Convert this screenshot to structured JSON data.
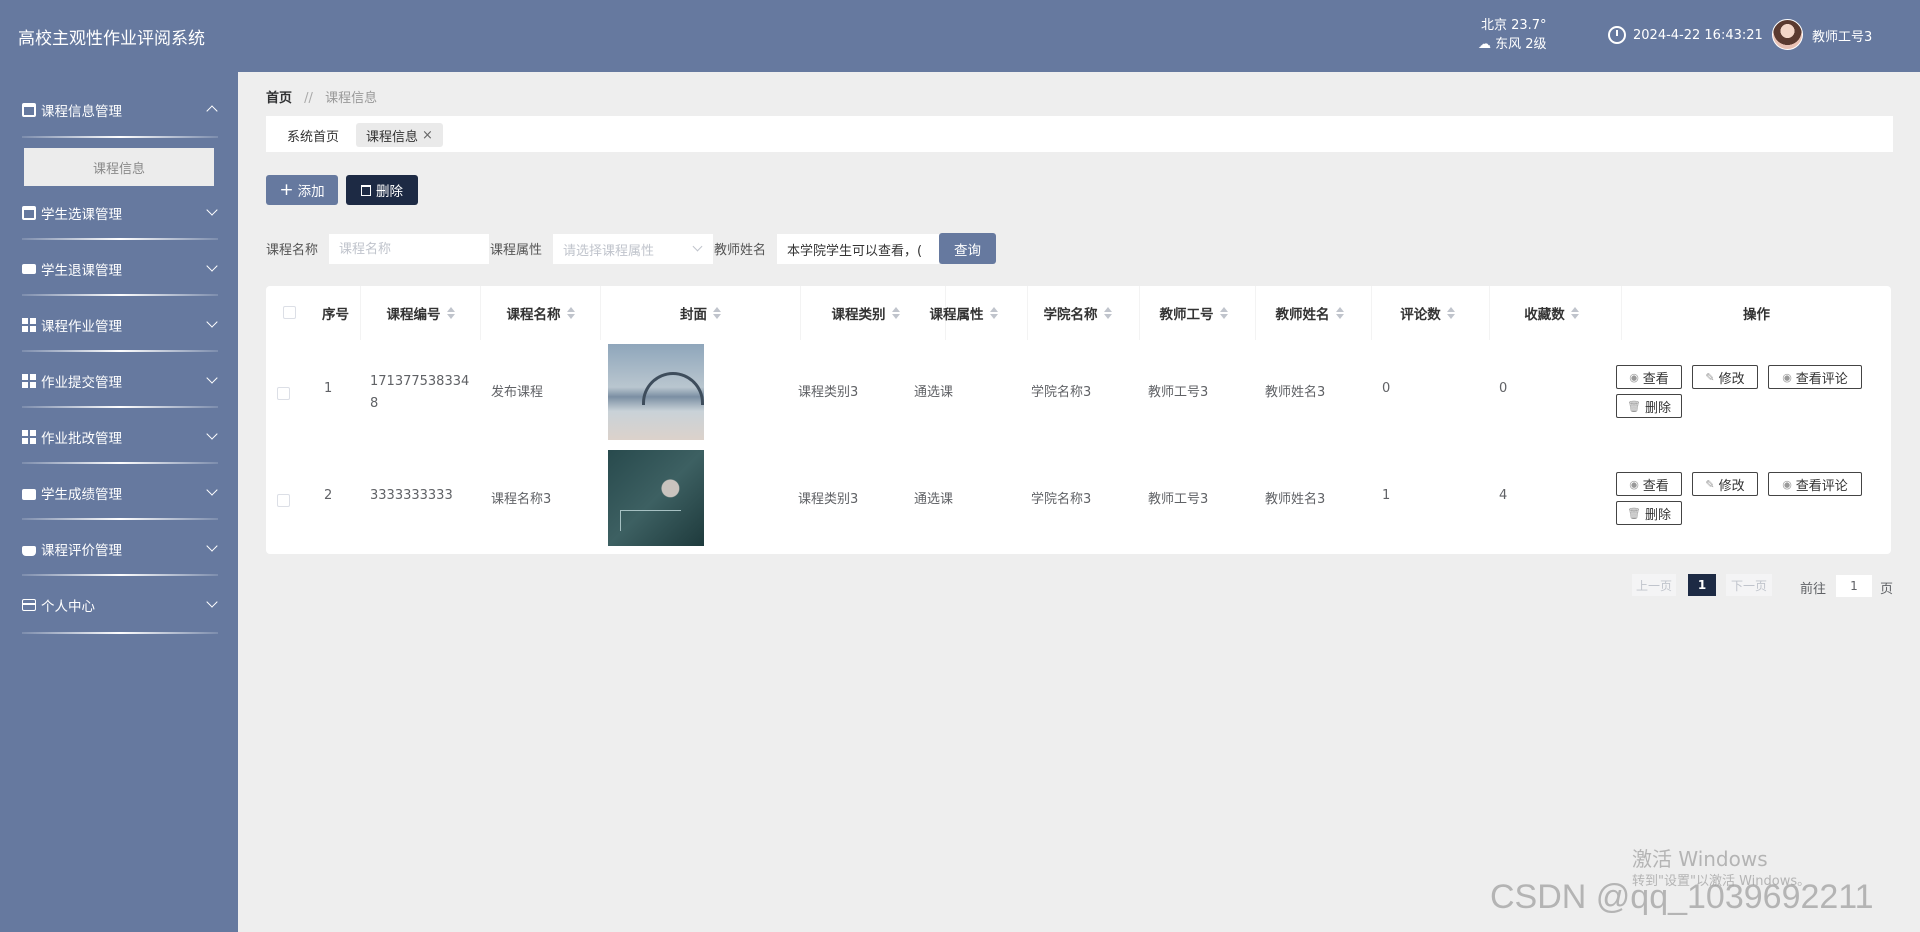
{
  "header": {
    "title": "高校主观性作业评阅系统",
    "weather_city_temp": "北京  23.7°",
    "weather_wind": "东风  2级",
    "datetime": "2024-4-22 16:43:21",
    "username": "教师工号3"
  },
  "sidebar": {
    "items": [
      {
        "label": "课程信息管理"
      },
      {
        "label": "学生选课管理"
      },
      {
        "label": "学生退课管理"
      },
      {
        "label": "课程作业管理"
      },
      {
        "label": "作业提交管理"
      },
      {
        "label": "作业批改管理"
      },
      {
        "label": "学生成绩管理"
      },
      {
        "label": "课程评价管理"
      },
      {
        "label": "个人中心"
      }
    ],
    "submenu_active": "课程信息"
  },
  "breadcrumb": {
    "home": "首页",
    "sep": "//",
    "current": "课程信息"
  },
  "tabs": [
    {
      "label": "系统首页"
    },
    {
      "label": "课程信息",
      "close": "×"
    }
  ],
  "toolbar": {
    "add_label": "添加",
    "delete_label": "删除",
    "add_icon": "+"
  },
  "filters": {
    "course_name_label": "课程名称",
    "course_name_placeholder": "课程名称",
    "course_attr_label": "课程属性",
    "course_attr_placeholder": "请选择课程属性",
    "teacher_name_label": "教师姓名",
    "teacher_name_value": "本学院学生可以查看，(",
    "search_label": "查询"
  },
  "table": {
    "headers": [
      "序号",
      "课程编号",
      "课程名称",
      "封面",
      "课程类别",
      "课程属性",
      "学院名称",
      "教师工号",
      "教师姓名",
      "评论数",
      "收藏数",
      "操作"
    ],
    "rows": [
      {
        "index": "1",
        "code_line1": "171377538334",
        "code_line2": "8",
        "name": "发布课程",
        "category": "课程类别3",
        "attr": "通选课",
        "college": "学院名称3",
        "teacher_id": "教师工号3",
        "teacher_name": "教师姓名3",
        "comments": "0",
        "favorites": "0"
      },
      {
        "index": "2",
        "code_line1": "3333333333",
        "code_line2": "",
        "name": "课程名称3",
        "category": "课程类别3",
        "attr": "通选课",
        "college": "学院名称3",
        "teacher_id": "教师工号3",
        "teacher_name": "教师姓名3",
        "comments": "1",
        "favorites": "4"
      }
    ],
    "ops": {
      "view": "查看",
      "edit": "修改",
      "view_comments": "查看评论",
      "delete": "删除"
    }
  },
  "pagination": {
    "prev": "上一页",
    "current": "1",
    "next": "下一页",
    "goto_prefix": "前往",
    "goto_value": "1",
    "goto_suffix": "页"
  },
  "watermarks": {
    "win_line1": "激活 Windows",
    "win_line2": "转到\"设置\"以激活 Windows。",
    "csdn": "CSDN @qq_1039692211"
  }
}
